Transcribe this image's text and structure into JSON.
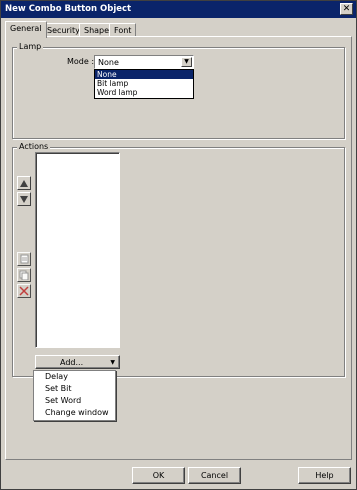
{
  "window": {
    "title": "New Combo Button Object",
    "close_glyph": "✕"
  },
  "tabs": [
    {
      "label": "General",
      "active": true
    },
    {
      "label": "Security",
      "active": false
    },
    {
      "label": "Shape",
      "active": false
    },
    {
      "label": "Font",
      "active": false
    }
  ],
  "lamp": {
    "group_label": "Lamp",
    "mode_label": "Mode :",
    "mode_value": "None",
    "options": [
      "None",
      "Bit lamp",
      "Word lamp"
    ],
    "selected_index": 0
  },
  "actions": {
    "group_label": "Actions",
    "add_button_label": "Add...",
    "add_menu_items": [
      "Delay",
      "Set Bit",
      "Set Word",
      "Change window"
    ],
    "list_items": []
  },
  "buttons": {
    "ok": "OK",
    "cancel": "Cancel",
    "help": "Help"
  },
  "colors": {
    "titlebar": "#0a246a",
    "face": "#d4d0c8",
    "selection": "#0a246a",
    "delete_icon": "#c03030"
  },
  "icons": [
    "close-icon",
    "chevron-down-icon",
    "move-up-icon",
    "move-down-icon",
    "edit-item-icon",
    "copy-item-icon",
    "delete-item-icon"
  ]
}
